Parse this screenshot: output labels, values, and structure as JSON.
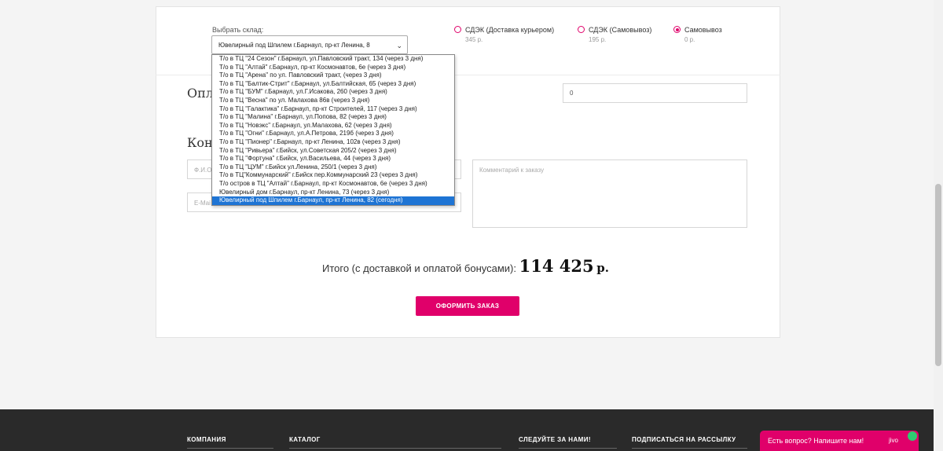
{
  "warehouse": {
    "label": "Выбрать склад:",
    "selected": "Ювелирный под Шпилем г.Барнаул, пр-кт Ленина, 8"
  },
  "shipping_options": [
    {
      "title": "СДЭК (Доставка курьером)",
      "price": "345 р.",
      "checked": false
    },
    {
      "title": "СДЭК (Самовывоз)",
      "price": "195 р.",
      "checked": false
    },
    {
      "title": "Самовывоз",
      "price": "0 р.",
      "checked": true
    }
  ],
  "payment": {
    "heading_partial": "Опла",
    "bonus_value": "0"
  },
  "contacts": {
    "heading_partial": "Конт",
    "name_placeholder": "Ф.И.О",
    "email_placeholder": "E-Mai",
    "comment_placeholder": "Комментарий к заказу"
  },
  "warehouse_list": [
    "Т/о в ТЦ \"24 Сезон\" г.Барнаул, ул.Павловский тракт, 134 (через 3 дня)",
    "Т/о в ТЦ \"Алтай\" г.Барнаул, пр-кт Космонавтов, 6е (через 3 дня)",
    "Т/о в ТЦ \"Арена\" по ул. Павловский тракт, (через 3 дня)",
    "Т/о в ТЦ \"Балтик-Стрит\" г.Барнаул, ул.Балтийская, 65 (через 3 дня)",
    "Т/о в ТЦ \"БУМ\" г.Барнаул, ул.Г.Исакова, 260 (через 3 дня)",
    "Т/о в ТЦ \"Весна\" по ул. Малахова 86в (через 3 дня)",
    "Т/о в ТЦ \"Галактика\" г.Барнаул, пр-кт Строителей, 117 (через 3 дня)",
    "Т/о в ТЦ \"Малина\" г.Барнаул, ул.Попова, 82 (через 3 дня)",
    "Т/о в ТЦ \"Новэкс\" г.Барнаул, ул.Малахова, 62 (через 3 дня)",
    "Т/о в ТЦ \"Огни\" г.Барнаул, ул.А.Петрова, 219б (через 3 дня)",
    "Т/о в ТЦ \"Пионер\" г.Барнаул, пр-кт Ленина, 102в (через 3 дня)",
    "Т/о в ТЦ \"Ривьера\" г.Бийск, ул.Советская 205/2 (через 3 дня)",
    "Т/о в ТЦ \"Фортуна\" г.Бийск, ул.Васильева, 44 (через 3 дня)",
    "Т/о в ТЦ \"ЦУМ\" г.Бийск ул.Ленина, 250/1 (через 3 дня)",
    "Т/о в ТЦ\"Коммунарский\" г.Бийск пер.Коммунарский 23 (через 3 дня)",
    "Т/о остров в ТЦ \"Алтай\" г.Барнаул, пр-кт Космонавтов, 6е (через 3 дня)",
    "Ювелирный дом г.Барнаул, пр-кт Ленина, 73 (через 3 дня)",
    "Ювелирный под Шпилем г.Барнаул, пр-кт Ленина, 82 (сегодня)"
  ],
  "selected_index": 17,
  "total": {
    "label": "Итого (с доставкой и оплатой бонусами):",
    "amount": "114 425",
    "currency": "р."
  },
  "order_button": "ОФОРМИТЬ ЗАКАЗ",
  "footer": {
    "company": "КОМПАНИЯ",
    "catalog": "КАТАЛОГ",
    "follow": "СЛЕДУЙТЕ ЗА НАМИ!",
    "subscribe": "ПОДПИСАТЬСЯ НА РАССЫЛКУ"
  },
  "chat": {
    "text": "Есть вопрос? Напишите нам!",
    "brand": "jivo"
  },
  "colors": {
    "accent": "#e0006a",
    "selection": "#1e74d4",
    "footer_bg": "#2a2a2a"
  }
}
